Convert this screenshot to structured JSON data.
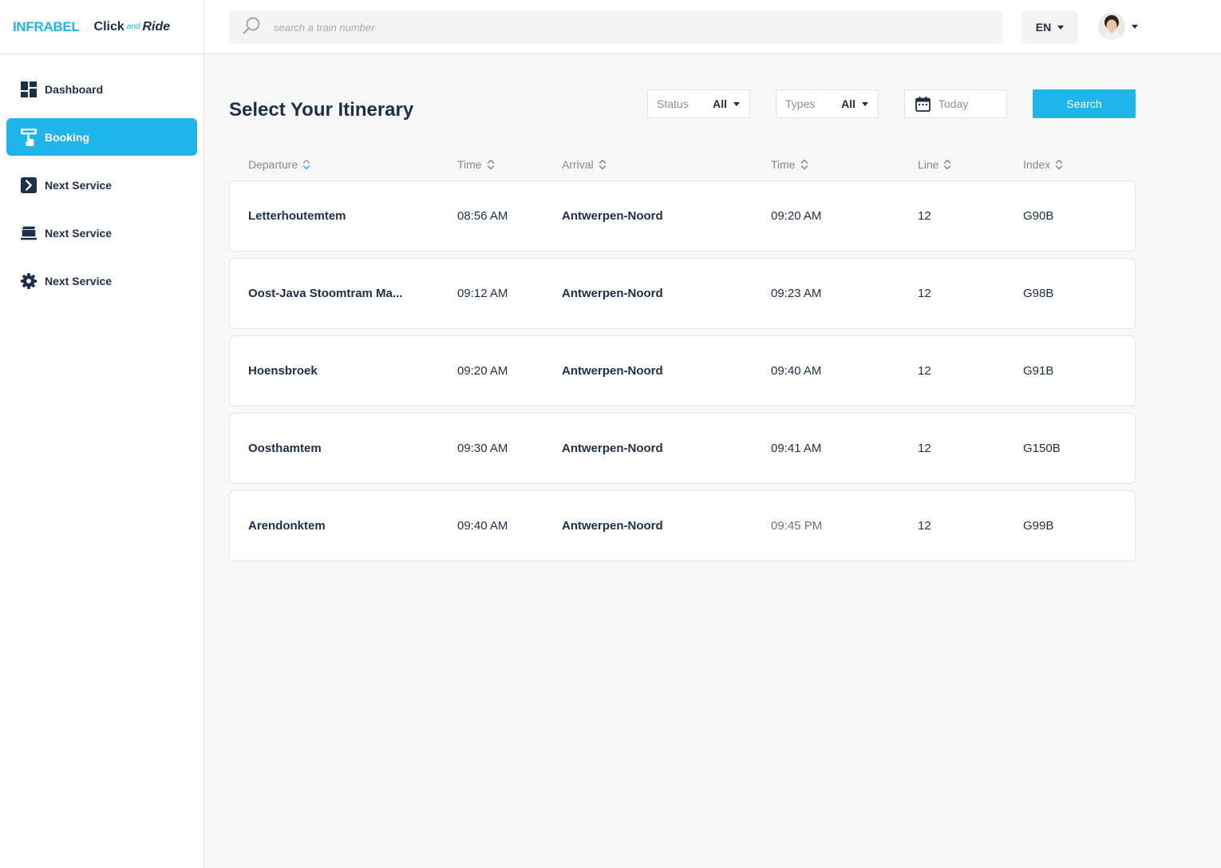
{
  "brand": {
    "name": "INFRABEL",
    "product_click": "Click",
    "product_and": "and",
    "product_ride": "Ride"
  },
  "sidebar": {
    "items": [
      {
        "label": "Dashboard",
        "icon": "dashboard-icon",
        "active": false
      },
      {
        "label": "Booking",
        "icon": "book-hand-icon",
        "active": true
      },
      {
        "label": "Next Service",
        "icon": "arrow-right-box-icon",
        "active": false
      },
      {
        "label": "Next Service",
        "icon": "tray-stack-icon",
        "active": false
      },
      {
        "label": "Next Service",
        "icon": "gear-icon",
        "active": false
      }
    ]
  },
  "topbar": {
    "search_placeholder": "search a train number",
    "language": "EN"
  },
  "main": {
    "title": "Select Your Itinerary",
    "filters": {
      "status_label": "Status",
      "status_value": "All",
      "types_label": "Types",
      "types_value": "All",
      "date_value": "Today",
      "search_button": "Search"
    },
    "columns": [
      "Departure",
      "Time",
      "Arrival",
      "Time",
      "Line",
      "Index"
    ],
    "rows": [
      {
        "departure": "Letterhoutemtem",
        "dep_time": "08:56 AM",
        "arrival": "Antwerpen-Noord",
        "arr_time": "09:20 AM",
        "line": "12",
        "index": "G90B"
      },
      {
        "departure": "Oost-Java Stoomtram Ma...",
        "dep_time": "09:12 AM",
        "arrival": "Antwerpen-Noord",
        "arr_time": "09:23 AM",
        "line": "12",
        "index": "G98B"
      },
      {
        "departure": "Hoensbroek",
        "dep_time": "09:20 AM",
        "arrival": "Antwerpen-Noord",
        "arr_time": "09:40 AM",
        "line": "12",
        "index": "G91B"
      },
      {
        "departure": "Oosthamtem",
        "dep_time": "09:30 AM",
        "arrival": "Antwerpen-Noord",
        "arr_time": "09:41 AM",
        "line": "12",
        "index": "G150B"
      },
      {
        "departure": "Arendonktem",
        "dep_time": "09:40 AM",
        "arrival": "Antwerpen-Noord",
        "arr_time": "09:45 PM",
        "line": "12",
        "index": "G99B"
      }
    ]
  },
  "colors": {
    "accent": "#1fb4ea",
    "text": "#1e2f4a",
    "muted": "#7f8893",
    "background": "#f8f8f8"
  }
}
